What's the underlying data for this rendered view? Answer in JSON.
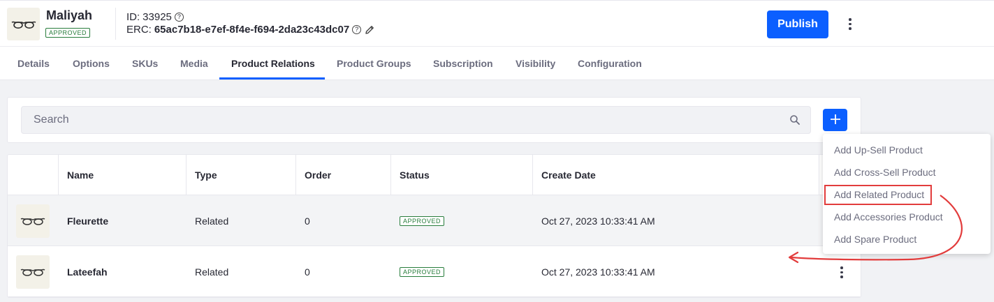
{
  "header": {
    "product_name": "Maliyah",
    "status_badge": "APPROVED",
    "id_label": "ID:",
    "id_value": "33925",
    "erc_label": "ERC:",
    "erc_value": "65ac7b18-e7ef-8f4e-f694-2da23c43dc07",
    "publish_label": "Publish"
  },
  "tabs": [
    {
      "label": "Details"
    },
    {
      "label": "Options"
    },
    {
      "label": "SKUs"
    },
    {
      "label": "Media"
    },
    {
      "label": "Product Relations",
      "active": true
    },
    {
      "label": "Product Groups"
    },
    {
      "label": "Subscription"
    },
    {
      "label": "Visibility"
    },
    {
      "label": "Configuration"
    }
  ],
  "search": {
    "placeholder": "Search"
  },
  "table": {
    "columns": [
      "Name",
      "Type",
      "Order",
      "Status",
      "Create Date"
    ],
    "rows": [
      {
        "name": "Fleurette",
        "type": "Related",
        "order": "0",
        "status": "APPROVED",
        "create_date": "Oct 27, 2023 10:33:41 AM"
      },
      {
        "name": "Lateefah",
        "type": "Related",
        "order": "0",
        "status": "APPROVED",
        "create_date": "Oct 27, 2023 10:33:41 AM"
      }
    ]
  },
  "dropdown": {
    "items": [
      {
        "label": "Add Up-Sell Product"
      },
      {
        "label": "Add Cross-Sell Product"
      },
      {
        "label": "Add Related Product",
        "highlighted": true
      },
      {
        "label": "Add Accessories Product"
      },
      {
        "label": "Add Spare Product"
      }
    ]
  },
  "colors": {
    "primary": "#0b5fff",
    "approved": "#287d3c",
    "annotation": "#e23c3c"
  },
  "icons": [
    "glasses-icon",
    "help-icon",
    "pencil-icon",
    "kebab-icon",
    "search-icon",
    "plus-icon"
  ]
}
